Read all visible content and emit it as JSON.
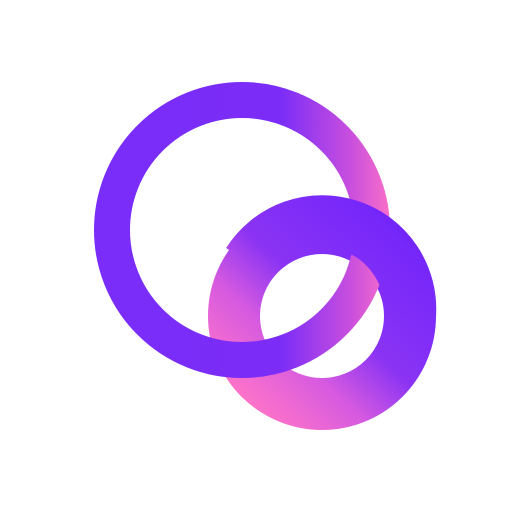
{
  "logo": {
    "icon": "two-overlapping-rings-logo",
    "colors": {
      "background": "#ffffff",
      "violet": "#7B2FF7",
      "purple": "#9A3CF0",
      "pink": "#FF6FC8"
    }
  }
}
